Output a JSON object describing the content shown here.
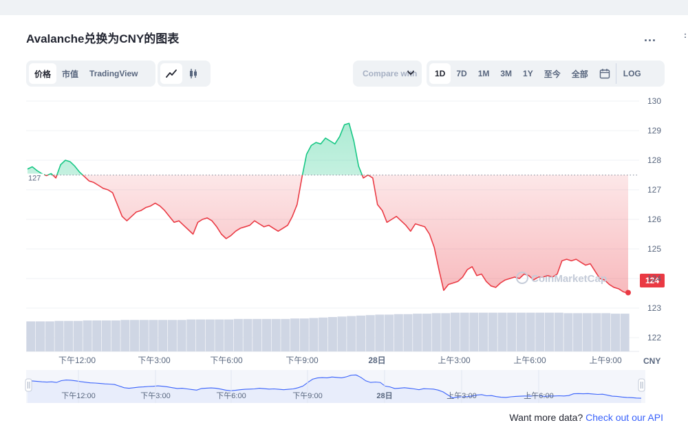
{
  "title": "Avalanche兑换为CNY的图表",
  "more_label": "...",
  "tabs": [
    {
      "label": "价格",
      "active": true
    },
    {
      "label": "市值",
      "active": false
    },
    {
      "label": "TradingView",
      "active": false
    }
  ],
  "chart_types": [
    "line-chart-icon",
    "candlestick-icon"
  ],
  "compare_label": "Compare with",
  "ranges": [
    {
      "label": "1D",
      "active": true
    },
    {
      "label": "7D",
      "active": false
    },
    {
      "label": "1M",
      "active": false
    },
    {
      "label": "3M",
      "active": false
    },
    {
      "label": "1Y",
      "active": false
    },
    {
      "label": "至今",
      "active": false
    },
    {
      "label": "全部",
      "active": false
    }
  ],
  "calendar_icon": "calendar-icon",
  "log_label": "LOG",
  "footer": {
    "text": "Want more data?",
    "link": "Check out our API"
  },
  "watermark": "CoinMarketCap",
  "colors": {
    "up": "#16c784",
    "down": "#ea3943",
    "volume": "#cfd6e4",
    "nav_fill": "#e8edfb",
    "nav_line": "#3861fb"
  },
  "chart_data": {
    "type": "area",
    "currency": "CNY",
    "ylim": [
      122,
      130
    ],
    "yticks": [
      130,
      129,
      128,
      127,
      126,
      125,
      124,
      123,
      122
    ],
    "baseline": 127.5,
    "baseline_label": "127",
    "current_label": "124",
    "xticks": [
      "下午12:00",
      "下午3:00",
      "下午6:00",
      "下午9:00",
      "28日",
      "上午3:00",
      "上午6:00",
      "上午9:00"
    ],
    "nav_xticks": [
      "下午12:00",
      "下午3:00",
      "下午6:00",
      "下午9:00",
      "28日",
      "上午3:00",
      "上午6:00"
    ],
    "price_series": [
      [
        0.0,
        127.7
      ],
      [
        0.5,
        127.78
      ],
      [
        1.0,
        127.65
      ],
      [
        1.5,
        127.55
      ],
      [
        2.0,
        127.48
      ],
      [
        2.5,
        127.55
      ],
      [
        3.0,
        127.4
      ],
      [
        3.5,
        127.85
      ],
      [
        4.0,
        128.0
      ],
      [
        4.5,
        127.95
      ],
      [
        5.0,
        127.8
      ],
      [
        5.5,
        127.6
      ],
      [
        6.0,
        127.45
      ],
      [
        6.5,
        127.3
      ],
      [
        7.0,
        127.25
      ],
      [
        7.5,
        127.15
      ],
      [
        8.0,
        127.05
      ],
      [
        8.5,
        127.0
      ],
      [
        9.0,
        126.9
      ],
      [
        9.5,
        126.5
      ],
      [
        10.0,
        126.1
      ],
      [
        10.5,
        125.95
      ],
      [
        11.0,
        126.1
      ],
      [
        11.5,
        126.25
      ],
      [
        12.0,
        126.3
      ],
      [
        12.5,
        126.4
      ],
      [
        13.0,
        126.45
      ],
      [
        13.5,
        126.55
      ],
      [
        14.0,
        126.45
      ],
      [
        14.5,
        126.3
      ],
      [
        15.0,
        126.1
      ],
      [
        15.5,
        125.9
      ],
      [
        16.0,
        125.95
      ],
      [
        16.5,
        125.8
      ],
      [
        17.0,
        125.65
      ],
      [
        17.5,
        125.5
      ],
      [
        18.0,
        125.9
      ],
      [
        18.5,
        126.0
      ],
      [
        19.0,
        126.05
      ],
      [
        19.5,
        125.95
      ],
      [
        20.0,
        125.75
      ],
      [
        20.5,
        125.5
      ],
      [
        21.0,
        125.35
      ],
      [
        21.5,
        125.45
      ],
      [
        22.0,
        125.6
      ],
      [
        22.5,
        125.7
      ],
      [
        23.0,
        125.75
      ],
      [
        23.5,
        125.8
      ],
      [
        24.0,
        125.95
      ],
      [
        24.5,
        125.85
      ],
      [
        25.0,
        125.75
      ],
      [
        25.5,
        125.8
      ],
      [
        26.0,
        125.7
      ],
      [
        26.5,
        125.6
      ],
      [
        27.0,
        125.7
      ],
      [
        27.5,
        125.8
      ],
      [
        28.0,
        126.1
      ],
      [
        28.5,
        126.5
      ],
      [
        29.0,
        127.4
      ],
      [
        29.5,
        128.2
      ],
      [
        30.0,
        128.5
      ],
      [
        30.5,
        128.6
      ],
      [
        31.0,
        128.55
      ],
      [
        31.5,
        128.75
      ],
      [
        32.0,
        128.65
      ],
      [
        32.5,
        128.55
      ],
      [
        33.0,
        128.8
      ],
      [
        33.5,
        129.2
      ],
      [
        34.0,
        129.25
      ],
      [
        34.5,
        128.65
      ],
      [
        35.0,
        127.8
      ],
      [
        35.5,
        127.4
      ],
      [
        36.0,
        127.5
      ],
      [
        36.5,
        127.4
      ],
      [
        37.0,
        126.5
      ],
      [
        37.5,
        126.3
      ],
      [
        38.0,
        125.9
      ],
      [
        38.5,
        126.0
      ],
      [
        39.0,
        126.1
      ],
      [
        39.5,
        125.95
      ],
      [
        40.0,
        125.8
      ],
      [
        40.5,
        125.6
      ],
      [
        41.0,
        125.85
      ],
      [
        41.5,
        125.8
      ],
      [
        42.0,
        125.75
      ],
      [
        42.5,
        125.5
      ],
      [
        43.0,
        125.05
      ],
      [
        43.5,
        124.3
      ],
      [
        44.0,
        123.6
      ],
      [
        44.5,
        123.8
      ],
      [
        45.0,
        123.85
      ],
      [
        45.5,
        123.9
      ],
      [
        46.0,
        124.05
      ],
      [
        46.5,
        124.3
      ],
      [
        47.0,
        124.4
      ],
      [
        47.5,
        124.1
      ],
      [
        48.0,
        124.15
      ],
      [
        48.5,
        123.9
      ],
      [
        49.0,
        123.75
      ],
      [
        49.5,
        123.7
      ],
      [
        50.0,
        123.85
      ],
      [
        50.5,
        123.95
      ],
      [
        51.0,
        124.0
      ],
      [
        51.5,
        124.05
      ],
      [
        52.0,
        124.0
      ],
      [
        52.5,
        124.15
      ],
      [
        53.0,
        124.1
      ],
      [
        53.5,
        123.95
      ],
      [
        54.0,
        124.05
      ],
      [
        54.5,
        124.05
      ],
      [
        55.0,
        124.1
      ],
      [
        55.5,
        124.05
      ],
      [
        56.0,
        124.15
      ],
      [
        56.5,
        124.6
      ],
      [
        57.0,
        124.65
      ],
      [
        57.5,
        124.6
      ],
      [
        58.0,
        124.65
      ],
      [
        58.5,
        124.55
      ],
      [
        59.0,
        124.45
      ],
      [
        59.5,
        124.5
      ],
      [
        60.0,
        124.25
      ],
      [
        60.5,
        124.0
      ],
      [
        61.0,
        123.95
      ],
      [
        61.5,
        123.8
      ],
      [
        62.0,
        123.7
      ],
      [
        62.5,
        123.65
      ],
      [
        63.0,
        123.55
      ],
      [
        63.5,
        123.5
      ]
    ],
    "volume_series": [
      0.62,
      0.62,
      0.62,
      0.63,
      0.63,
      0.63,
      0.64,
      0.64,
      0.64,
      0.64,
      0.65,
      0.65,
      0.65,
      0.65,
      0.65,
      0.65,
      0.65,
      0.66,
      0.66,
      0.66,
      0.66,
      0.66,
      0.67,
      0.67,
      0.67,
      0.67,
      0.67,
      0.67,
      0.68,
      0.68,
      0.69,
      0.7,
      0.71,
      0.72,
      0.73,
      0.74,
      0.75,
      0.76,
      0.76,
      0.77,
      0.77,
      0.78,
      0.78,
      0.79,
      0.79,
      0.8,
      0.8,
      0.8,
      0.8,
      0.8,
      0.8,
      0.8,
      0.8,
      0.8,
      0.8,
      0.8,
      0.8,
      0.79,
      0.79,
      0.79,
      0.79,
      0.79,
      0.78,
      0.78
    ]
  }
}
